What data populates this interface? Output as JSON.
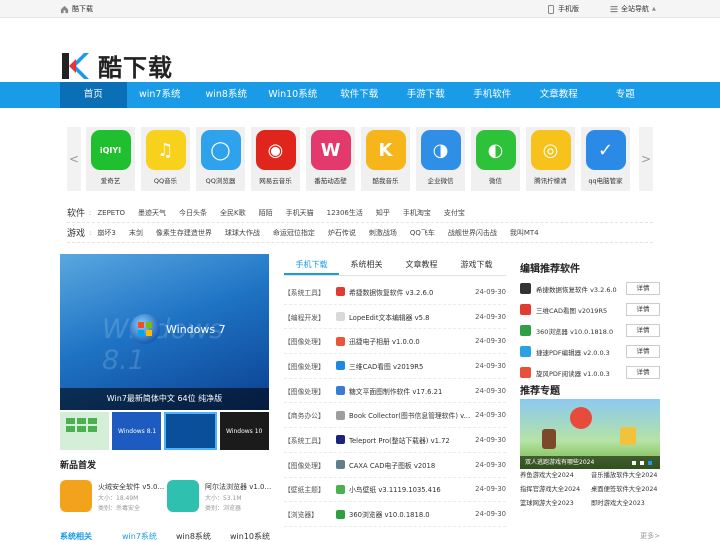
{
  "topbar": {
    "home_label": "酷下载",
    "mobile_label": "手机版",
    "sitenav_label": "全站导航"
  },
  "logo": {
    "text": "酷下载"
  },
  "nav": {
    "items": [
      "首页",
      "win7系统",
      "win8系统",
      "Win10系统",
      "软件下载",
      "手游下载",
      "手机软件",
      "文章教程",
      "专题"
    ]
  },
  "apps": [
    {
      "name": "爱奇艺",
      "color": "#1fbf2f",
      "icon": "iqiyi-icon",
      "glyph": "iQIYI"
    },
    {
      "name": "QQ音乐",
      "color": "#f7d11b",
      "icon": "music-icon",
      "glyph": "♫"
    },
    {
      "name": "QQ浏览器",
      "color": "#2fa2ec",
      "icon": "browser-icon",
      "glyph": "◯"
    },
    {
      "name": "网易云音乐",
      "color": "#e0261c",
      "icon": "netease-music-icon",
      "glyph": "◉"
    },
    {
      "name": "番茄动态壁",
      "color": "#e3396c",
      "icon": "tomato-wallpaper-icon",
      "glyph": "W"
    },
    {
      "name": "酷我音乐",
      "color": "#f7b51c",
      "icon": "kuwo-icon",
      "glyph": "K"
    },
    {
      "name": "企业微信",
      "color": "#2f8ee5",
      "icon": "wecom-icon",
      "glyph": "◑"
    },
    {
      "name": "微信",
      "color": "#2ec13a",
      "icon": "wechat-icon",
      "glyph": "◐"
    },
    {
      "name": "腾讯柠檬清",
      "color": "#f7c21b",
      "icon": "lemon-icon",
      "glyph": "◎"
    },
    {
      "name": "qq电脑管家",
      "color": "#2b8ae6",
      "icon": "qq-guard-icon",
      "glyph": "✓"
    }
  ],
  "tags": {
    "software_label": "软件",
    "software": [
      "ZEPETO",
      "墨迹天气",
      "今日头条",
      "全民K歌",
      "陌陌",
      "手机天猫",
      "12306生活",
      "知乎",
      "手机淘宝",
      "支付宝"
    ],
    "game_label": "游戏",
    "game": [
      "崩坏3",
      "末剑",
      "像素生存建造世界",
      "球球大作战",
      "命运冠位指定",
      "炉石传说",
      "刺激战场",
      "QQ飞车",
      "战舰世界闪击战",
      "我叫MT4"
    ]
  },
  "hero": {
    "caption": "Win7最新简体中文 64位 纯净版",
    "win_label": "Windows 7",
    "ghost": "Windows 8.1"
  },
  "thumbs": [
    {
      "label": ""
    },
    {
      "label": "Windows 8.1"
    },
    {
      "label": ""
    },
    {
      "label": "Windows 10"
    }
  ],
  "newfirst": {
    "title": "新品首发",
    "items": [
      {
        "title": "火绒安全软件 v5.0...",
        "size": "大小：18.49M",
        "cat": "类别：杀毒安全",
        "color": "#f3a21b"
      },
      {
        "title": "阿尔法浏览器 v1.0...",
        "size": "大小：53.1M",
        "cat": "类别：浏览器",
        "color": "#2fc0b0"
      }
    ]
  },
  "tabs": [
    "手机下载",
    "系统相关",
    "文章教程",
    "游戏下载"
  ],
  "software_list": [
    {
      "cat": "【系统工具】",
      "name": "希捷数据恢复软件 v3.2.6.0",
      "date": "24-09-30",
      "color": "#e03c31"
    },
    {
      "cat": "【编程开发】",
      "name": "LopeEdit文本编辑器 v5.8",
      "date": "24-09-30",
      "color": "#d9d9d9"
    },
    {
      "cat": "【图像处理】",
      "name": "迅捷电子相册 v1.0.0.0",
      "date": "24-09-30",
      "color": "#e8563a"
    },
    {
      "cat": "【图像处理】",
      "name": "三维CAD看图 v2019R5",
      "date": "24-09-30",
      "color": "#1e88e5"
    },
    {
      "cat": "【图像处理】",
      "name": "糖文平面图制作软件 v17.6.21",
      "date": "24-09-30",
      "color": "#3a7bd5"
    },
    {
      "cat": "【商务办公】",
      "name": "Book Collector(图书信息管理软件) v...",
      "date": "24-09-30",
      "color": "#9e9e9e"
    },
    {
      "cat": "【系统工具】",
      "name": "Teleport Pro(整站下载器) v1.72",
      "date": "24-09-30",
      "color": "#1a237e"
    },
    {
      "cat": "【图像处理】",
      "name": "CAXA CAD电子图板 v2018",
      "date": "24-09-30",
      "color": "#607d8b"
    },
    {
      "cat": "【壁纸主题】",
      "name": "小鸟壁纸 v3.1119.1035.416",
      "date": "24-09-30",
      "color": "#4caf50"
    },
    {
      "cat": "【浏览器】",
      "name": "360浏览器 v10.0.1818.0",
      "date": "24-09-30",
      "color": "#2ea043"
    }
  ],
  "editor": {
    "title": "编辑推荐软件",
    "button_label": "详情",
    "items": [
      {
        "name": "希捷数据恢复软件 v3.2.6.0",
        "color": "#333"
      },
      {
        "name": "三维CAD看图 v2019R5",
        "color": "#e03c31"
      },
      {
        "name": "360浏览器 v10.0.1818.0",
        "color": "#2ea043"
      },
      {
        "name": "捷速PDF编辑器 v2.0.0.3",
        "color": "#29a3e0"
      },
      {
        "name": "旋风PDF阅读器 v1.0.0.3",
        "color": "#e8503a"
      }
    ]
  },
  "topic": {
    "title": "推荐专题",
    "banner_caption": "双人逃跑游戏有哪些2024",
    "links": [
      "养鱼游戏大全2024",
      "音乐播放软件大全2024",
      "指挥官游戏大全2024",
      "桌面便签软件大全2024",
      "篮球网游大全2023",
      "即时游戏大全2023"
    ]
  },
  "bottom": {
    "title": "系统相关",
    "tabs": [
      "win7系统",
      "win8系统",
      "win10系统"
    ],
    "more": "更多>"
  }
}
